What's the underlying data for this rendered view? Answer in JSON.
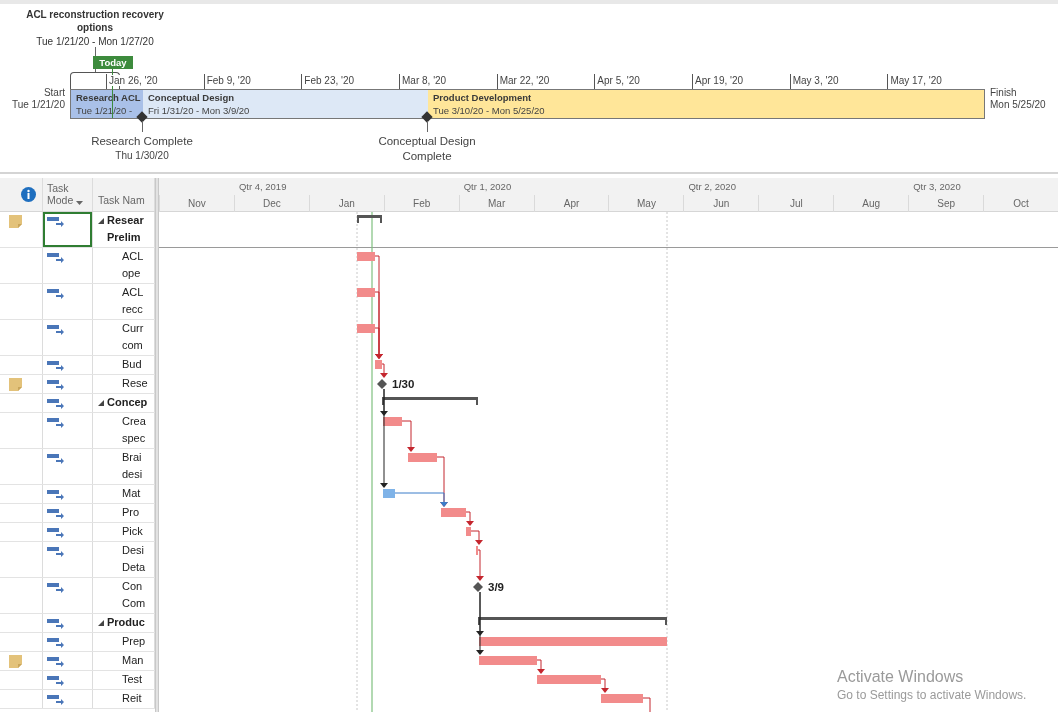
{
  "timeline": {
    "callout": {
      "title": "ACL reconstruction recovery options",
      "dates": "Tue 1/21/20 - Mon 1/27/20"
    },
    "today_label": "Today",
    "start": {
      "label": "Start",
      "date": "Tue 1/21/20"
    },
    "finish": {
      "label": "Finish",
      "date": "Mon 5/25/20"
    },
    "ticks": [
      "Jan 26, '20",
      "Feb 9, '20",
      "Feb 23, '20",
      "Mar 8, '20",
      "Mar 22, '20",
      "Apr 5, '20",
      "Apr 19, '20",
      "May 3, '20",
      "May 17, '20"
    ],
    "segments": [
      {
        "title": "Research ACL",
        "dates": "Tue 1/21/20 -",
        "color": "#a9c0e8"
      },
      {
        "title": "Conceptual Design",
        "dates": "Fri 1/31/20 - Mon 3/9/20",
        "color": "#dde8f6"
      },
      {
        "title": "Product Development",
        "dates": "Tue 3/10/20 - Mon 5/25/20",
        "color": "#ffe699"
      }
    ],
    "milestones": [
      {
        "title": "Research Complete",
        "date": "Thu 1/30/20"
      },
      {
        "title": "Conceptual Design Complete"
      }
    ]
  },
  "table": {
    "columns": [
      "Task Mode",
      "Task Nam"
    ],
    "quarters": [
      "Qtr 4, 2019",
      "Qtr 1, 2020",
      "Qtr 2, 2020",
      "Qtr 3, 2020"
    ],
    "months": [
      "Nov",
      "Dec",
      "Jan",
      "Feb",
      "Mar",
      "Apr",
      "May",
      "Jun",
      "Jul",
      "Aug",
      "Sep",
      "Oct"
    ],
    "rows": [
      {
        "name": "Resear Prelim",
        "kind": "summary",
        "expanded": true,
        "selected": true,
        "has_note": true,
        "critical": true
      },
      {
        "name": "ACL ope",
        "kind": "task",
        "selected": false,
        "has_note": false,
        "critical": true
      },
      {
        "name": "ACL recc",
        "kind": "task",
        "selected": false,
        "has_note": false,
        "critical": true
      },
      {
        "name": "Curr com",
        "kind": "task",
        "selected": false,
        "has_note": false,
        "critical": true
      },
      {
        "name": "Bud",
        "kind": "task",
        "selected": false,
        "has_note": false,
        "critical": true
      },
      {
        "name": "Rese",
        "kind": "milestone",
        "selected": false,
        "has_note": true,
        "critical": true,
        "bar_label": "1/30"
      },
      {
        "name": "Concep",
        "kind": "summary",
        "expanded": true,
        "selected": false,
        "has_note": false,
        "critical": true
      },
      {
        "name": "Crea spec",
        "kind": "task",
        "selected": false,
        "has_note": false,
        "critical": true
      },
      {
        "name": "Brai desi",
        "kind": "task",
        "selected": false,
        "has_note": false,
        "critical": true
      },
      {
        "name": "Mat",
        "kind": "task",
        "selected": false,
        "has_note": false,
        "critical": false
      },
      {
        "name": "Pro",
        "kind": "task",
        "selected": false,
        "has_note": false,
        "critical": true
      },
      {
        "name": "Pick",
        "kind": "task",
        "selected": false,
        "has_note": false,
        "critical": true
      },
      {
        "name": "Desi Deta",
        "kind": "task",
        "selected": false,
        "has_note": false,
        "critical": true
      },
      {
        "name": "Con Com",
        "kind": "milestone",
        "selected": false,
        "has_note": false,
        "critical": true,
        "bar_label": "3/9"
      },
      {
        "name": "Produc",
        "kind": "summary",
        "expanded": true,
        "selected": false,
        "has_note": false,
        "critical": true
      },
      {
        "name": "Prep",
        "kind": "task",
        "selected": false,
        "has_note": false,
        "critical": true
      },
      {
        "name": "Man",
        "kind": "task",
        "selected": false,
        "has_note": true,
        "critical": true
      },
      {
        "name": "Test",
        "kind": "task",
        "selected": false,
        "has_note": false,
        "critical": true
      },
      {
        "name": "Reit",
        "kind": "task",
        "selected": false,
        "has_note": false,
        "critical": true
      }
    ]
  },
  "os_notice": {
    "title": "Activate Windows",
    "text": "Go to Settings to activate Windows."
  }
}
